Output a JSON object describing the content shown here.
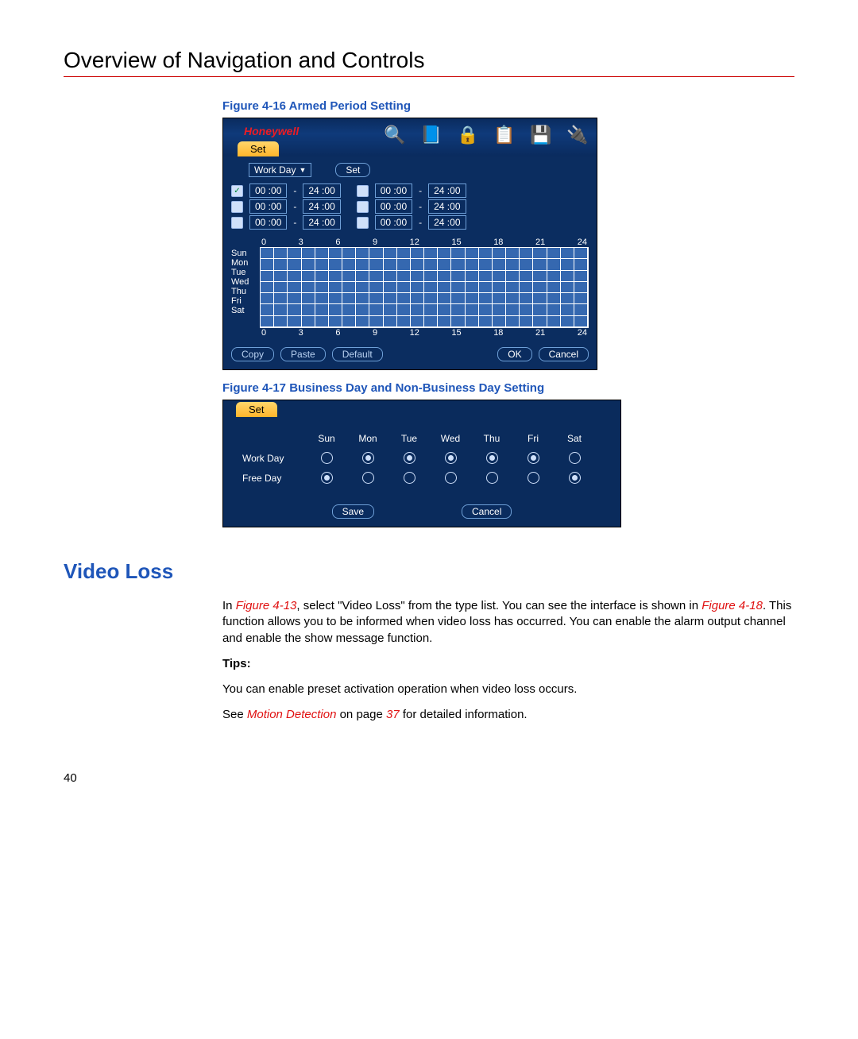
{
  "page": {
    "title": "Overview of Navigation and Controls",
    "number": "40"
  },
  "figure16": {
    "caption": "Figure 4-16 Armed Period Setting",
    "brand": "Honeywell",
    "tab": "Set",
    "workday_label": "Work Day",
    "set_button": "Set",
    "periods": [
      {
        "checked": true,
        "from": "00 :00",
        "to": "24 :00"
      },
      {
        "checked": false,
        "from": "00 :00",
        "to": "24 :00"
      },
      {
        "checked": false,
        "from": "00 :00",
        "to": "24 :00"
      },
      {
        "checked": false,
        "from": "00 :00",
        "to": "24 :00"
      },
      {
        "checked": false,
        "from": "00 :00",
        "to": "24 :00"
      },
      {
        "checked": false,
        "from": "00 :00",
        "to": "24 :00"
      }
    ],
    "hours": [
      "0",
      "3",
      "6",
      "9",
      "12",
      "15",
      "18",
      "21",
      "24"
    ],
    "days": [
      "Sun",
      "Mon",
      "Tue",
      "Wed",
      "Thu",
      "Fri",
      "Sat"
    ],
    "buttons": {
      "copy": "Copy",
      "paste": "Paste",
      "default": "Default",
      "ok": "OK",
      "cancel": "Cancel"
    }
  },
  "figure17": {
    "caption": "Figure 4-17 Business Day and Non-Business Day Setting",
    "tab": "Set",
    "days": [
      "Sun",
      "Mon",
      "Tue",
      "Wed",
      "Thu",
      "Fri",
      "Sat"
    ],
    "rows": [
      {
        "label": "Work Day",
        "sel": [
          false,
          true,
          true,
          true,
          true,
          true,
          false
        ]
      },
      {
        "label": "Free Day",
        "sel": [
          true,
          false,
          false,
          false,
          false,
          false,
          true
        ]
      }
    ],
    "buttons": {
      "save": "Save",
      "cancel": "Cancel"
    }
  },
  "video_loss": {
    "heading": "Video Loss",
    "para1_a": "In ",
    "para1_link1": "Figure 4-13",
    "para1_b": ", select \"Video Loss\" from the type list. You can see the interface is shown in ",
    "para1_link2": "Figure 4-18",
    "para1_c": ". This function allows you to be informed when video loss has occurred. You can enable the alarm output channel and enable the show message function.",
    "tips_label": "Tips:",
    "tips_text": "You can enable preset activation operation when video loss occurs.",
    "see_a": "See ",
    "see_link": "Motion Detection",
    "see_b": " on page ",
    "see_page": "37",
    "see_c": " for detailed information."
  }
}
